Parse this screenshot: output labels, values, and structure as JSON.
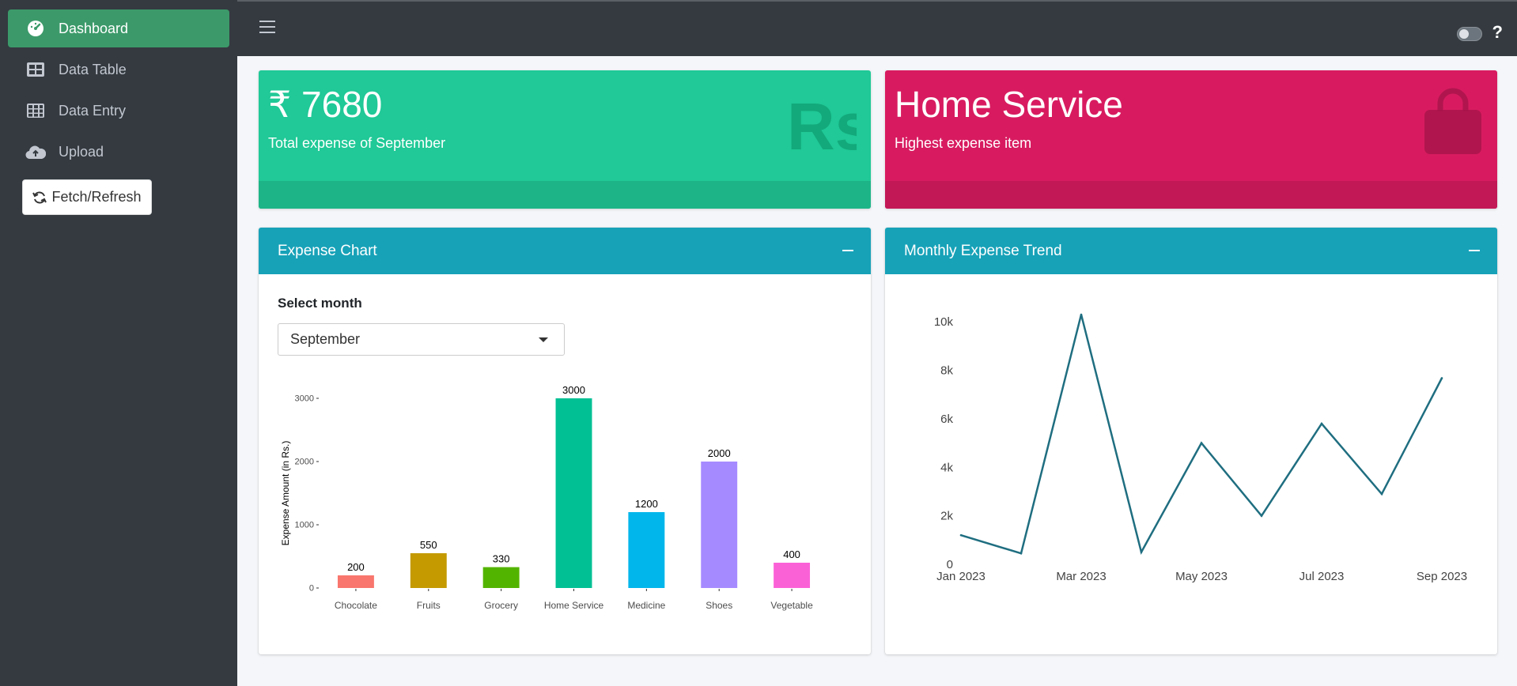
{
  "sidebar": {
    "items": [
      {
        "label": "Dashboard",
        "icon": "tachometer-icon",
        "active": true
      },
      {
        "label": "Data Table",
        "icon": "table-icon",
        "active": false
      },
      {
        "label": "Data Entry",
        "icon": "grid-icon",
        "active": false
      },
      {
        "label": "Upload",
        "icon": "cloud-upload-icon",
        "active": false
      }
    ],
    "fetch_label": "Fetch/Refresh"
  },
  "topbar": {
    "help_label": "?"
  },
  "infoboxes": {
    "total": {
      "value": "₹ 7680",
      "label": "Total expense of September",
      "icon_text": "Rs",
      "color": "#20c997"
    },
    "highest": {
      "value": "Home Service",
      "label": "Highest expense item",
      "icon": "shopping-bag-icon",
      "color": "#d81b60"
    }
  },
  "expense_card": {
    "title": "Expense Chart",
    "select_label": "Select month",
    "selected_month": "September"
  },
  "trend_card": {
    "title": "Monthly Expense Trend"
  },
  "chart_data": [
    {
      "type": "bar",
      "title": "",
      "xlabel": "",
      "ylabel": "Expense Amount (in Rs.)",
      "categories": [
        "Chocolate",
        "Fruits",
        "Grocery",
        "Home Service",
        "Medicine",
        "Shoes",
        "Vegetable"
      ],
      "values": [
        200,
        550,
        330,
        3000,
        1200,
        2000,
        400
      ],
      "colors": [
        "#f8766d",
        "#c49a00",
        "#53b400",
        "#00c094",
        "#00b6eb",
        "#a58aff",
        "#fb61d7"
      ],
      "ylim": [
        0,
        3000
      ],
      "yticks": [
        0,
        1000,
        2000,
        3000
      ],
      "ytick_labels": [
        "0",
        "1000",
        "2000",
        "3000"
      ],
      "data_labels": true,
      "grid": false
    },
    {
      "type": "line",
      "title": "",
      "xlabel": "",
      "ylabel": "",
      "x": [
        "Jan 2023",
        "Feb 2023",
        "Mar 2023",
        "Apr 2023",
        "May 2023",
        "Jun 2023",
        "Jul 2023",
        "Aug 2023",
        "Sep 2023"
      ],
      "values": [
        1200,
        450,
        10300,
        500,
        5000,
        2000,
        5800,
        2900,
        7680
      ],
      "xtick_labels": [
        "Jan 2023",
        "Mar 2023",
        "May 2023",
        "Jul 2023",
        "Sep 2023"
      ],
      "yticks": [
        0,
        2000,
        4000,
        6000,
        8000,
        10000
      ],
      "ytick_labels": [
        "0",
        "2k",
        "4k",
        "6k",
        "8k",
        "10k"
      ],
      "ylim": [
        0,
        10300
      ],
      "color": "#1f6e80",
      "grid": false
    }
  ]
}
